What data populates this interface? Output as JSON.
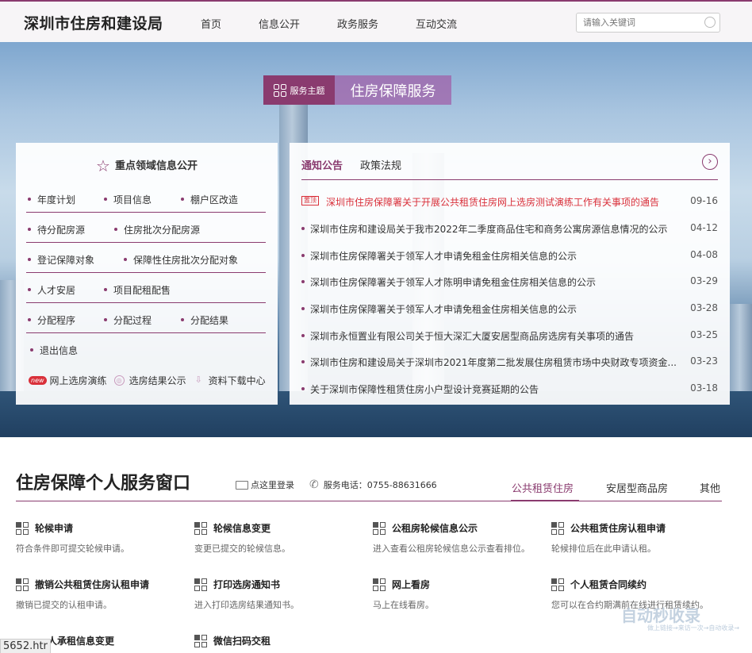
{
  "header": {
    "site_title": "深圳市住房和建设局",
    "nav": [
      "首页",
      "信息公开",
      "政务服务",
      "互动交流"
    ],
    "search_placeholder": "请输入关键词"
  },
  "theme": {
    "label": "服务主题",
    "title": "住房保障服务"
  },
  "key_info": {
    "title": "重点领域信息公开",
    "rows": [
      [
        "年度计划",
        "项目信息",
        "棚户区改造"
      ],
      [
        "待分配房源",
        "住房批次分配房源"
      ],
      [
        "登记保障对象",
        "保障性住房批次分配对象"
      ],
      [
        "人才安居",
        "项目配租配售"
      ],
      [
        "分配程序",
        "分配过程",
        "分配结果"
      ],
      [
        "退出信息"
      ]
    ],
    "bottom_links": [
      "网上选房演练",
      "选房结果公示",
      "资料下载中心"
    ],
    "new_badge": "new"
  },
  "notices": {
    "tabs": [
      "通知公告",
      "政策法规"
    ],
    "hot_badge": "置顶",
    "more_symbol": "›",
    "items": [
      {
        "title": "深圳市住房保障署关于开展公共租赁住房网上选房测试演练工作有关事项的通告",
        "date": "09-16"
      },
      {
        "title": "深圳市住房和建设局关于我市2022年二季度商品住宅和商务公寓房源信息情况的公示",
        "date": "04-12"
      },
      {
        "title": "深圳市住房保障署关于领军人才申请免租金住房相关信息的公示",
        "date": "04-08"
      },
      {
        "title": "深圳市住房保障署关于领军人才陈明申请免租金住房相关信息的公示",
        "date": "03-29"
      },
      {
        "title": "深圳市住房保障署关于领军人才申请免租金住房相关信息的公示",
        "date": "03-28"
      },
      {
        "title": "深圳市永恒置业有限公司关于恒大深汇大厦安居型商品房选房有关事项的通告",
        "date": "03-25"
      },
      {
        "title": "深圳市住房和建设局关于深圳市2021年度第二批发展住房租赁市场中央财政专项资金...",
        "date": "03-23"
      },
      {
        "title": "关于深圳市保障性租赁住房小户型设计竞赛延期的公告",
        "date": "03-18"
      }
    ]
  },
  "service_window": {
    "title": "住房保障个人服务窗口",
    "login": "点这里登录",
    "phone": "服务电话：0755-88631666",
    "tabs": [
      "公共租赁住房",
      "安居型商品房",
      "其他"
    ],
    "items": [
      {
        "title": "轮候申请",
        "desc": "符合条件即可提交轮候申请。"
      },
      {
        "title": "轮候信息变更",
        "desc": "变更已提交的轮候信息。"
      },
      {
        "title": "公租房轮候信息公示",
        "desc": "进入查看公租房轮候信息公示查看排位。"
      },
      {
        "title": "公共租赁住房认租申请",
        "desc": "轮候排位后在此申请认租。"
      },
      {
        "title": "撤销公共租赁住房认租申请",
        "desc": "撤销已提交的认租申请。"
      },
      {
        "title": "打印选房通知书",
        "desc": "进入打印选房结果通知书。"
      },
      {
        "title": "网上看房",
        "desc": "马上在线看房。"
      },
      {
        "title": "个人租赁合同续约",
        "desc": "您可以在合约期满前在线进行租赁续约。"
      },
      {
        "title": "人承租信息变更",
        "desc": ""
      },
      {
        "title": "微信扫码交租",
        "desc": ""
      }
    ]
  },
  "overlay": {
    "watermark": "自动秒收录",
    "watermark_sub": "做上链接→来访一次→自动收录→",
    "status_url": "5652.htr"
  }
}
